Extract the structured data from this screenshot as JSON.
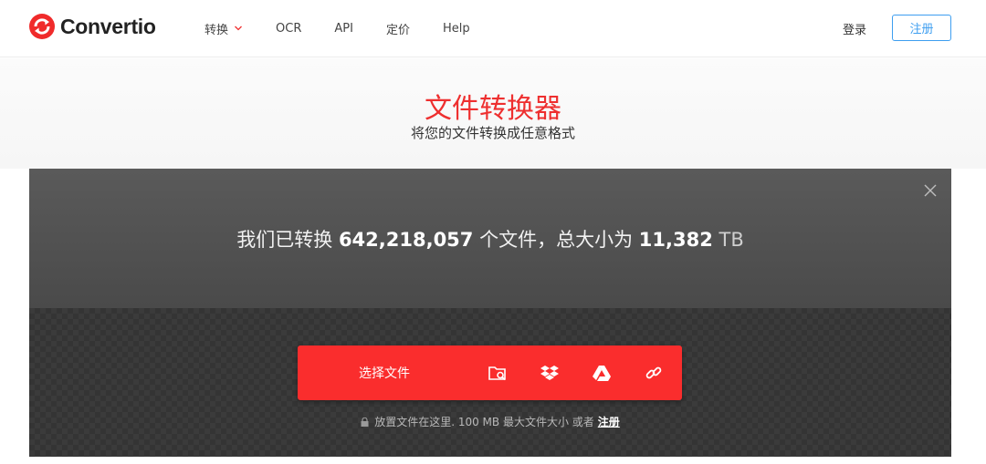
{
  "header": {
    "logo_text": "Convertio",
    "nav": [
      {
        "label": "转换",
        "dropdown": true
      },
      {
        "label": "OCR"
      },
      {
        "label": "API"
      },
      {
        "label": "定价"
      },
      {
        "label": "Help"
      }
    ],
    "login_label": "登录",
    "signup_label": "注册"
  },
  "hero": {
    "title": "文件转换器",
    "subtitle": "将您的文件转换成任意格式"
  },
  "panel": {
    "stats_prefix": "我们已转换",
    "file_count": "642,218,057",
    "stats_middle": "个文件，总大小为",
    "total_size": "11,382",
    "size_unit": "TB",
    "choose_label": "选择文件",
    "sources": [
      "folder-search-icon",
      "dropbox-icon",
      "google-drive-icon",
      "url-link-icon"
    ],
    "note_prefix": "放置文件在这里. 100 MB 最大文件大小 或者",
    "note_link": "注册"
  },
  "colors": {
    "brand_red": "#fa2d2d",
    "title_red": "#ee2f2f",
    "accent_blue": "#3d9ef0"
  }
}
